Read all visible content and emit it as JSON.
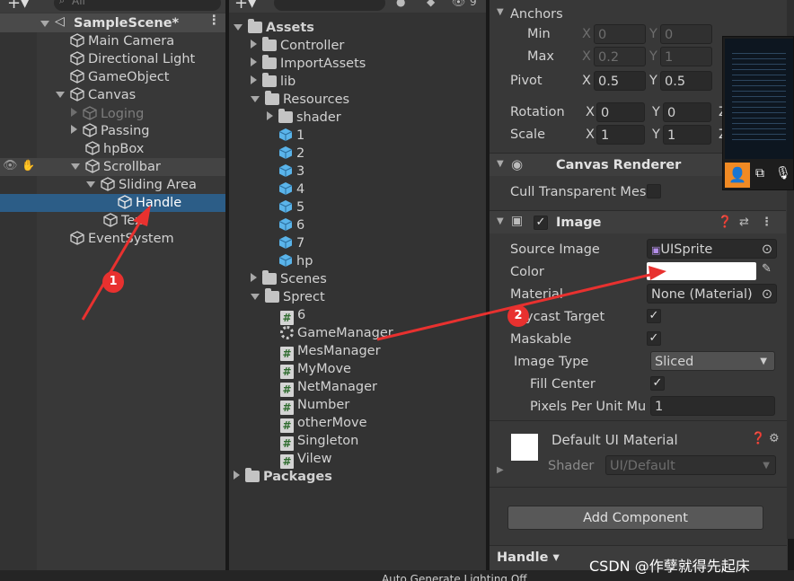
{
  "hierarchy": {
    "search_placeholder": "All",
    "scene": "SampleScene*",
    "items": [
      {
        "label": "Main Camera"
      },
      {
        "label": "Directional Light"
      },
      {
        "label": "GameObject"
      },
      {
        "label": "Canvas"
      },
      {
        "label": "Loging"
      },
      {
        "label": "Passing"
      },
      {
        "label": "hpBox"
      },
      {
        "label": "Scrollbar"
      },
      {
        "label": "Sliding Area"
      },
      {
        "label": "Handle"
      },
      {
        "label": "Tex"
      },
      {
        "label": "EventSystem"
      }
    ]
  },
  "project": {
    "items": [
      {
        "label": "Assets"
      },
      {
        "label": "Controller"
      },
      {
        "label": "ImportAssets"
      },
      {
        "label": "lib"
      },
      {
        "label": "Resources"
      },
      {
        "label": "shader"
      },
      {
        "label": "1"
      },
      {
        "label": "2"
      },
      {
        "label": "3"
      },
      {
        "label": "4"
      },
      {
        "label": "5"
      },
      {
        "label": "6"
      },
      {
        "label": "7"
      },
      {
        "label": "hp"
      },
      {
        "label": "Scenes"
      },
      {
        "label": "Sprect"
      },
      {
        "label": "6"
      },
      {
        "label": "GameManager"
      },
      {
        "label": "MesManager"
      },
      {
        "label": "MyMove"
      },
      {
        "label": "NetManager"
      },
      {
        "label": "Number"
      },
      {
        "label": "otherMove"
      },
      {
        "label": "Singleton"
      },
      {
        "label": "Vilew"
      },
      {
        "label": "Packages"
      }
    ],
    "top_count": "9"
  },
  "inspector": {
    "anchors": "Anchors",
    "min": "Min",
    "max": "Max",
    "min_x": "0",
    "min_y": "0",
    "max_x": "0.2",
    "max_y": "1",
    "pivot": "Pivot",
    "pivot_x": "0.5",
    "pivot_y": "0.5",
    "rotation": "Rotation",
    "rot_x": "0",
    "rot_y": "0",
    "scale": "Scale",
    "scale_x": "1",
    "scale_y": "1",
    "x": "X",
    "y": "Y",
    "z": "Z",
    "canvas_renderer": "Canvas Renderer",
    "cull_label": "Cull Transparent Mes",
    "image_title": "Image",
    "source_image_label": "Source Image",
    "source_image_value": "UISprite",
    "color_label": "Color",
    "material_label": "Material",
    "material_value": "None (Material)",
    "raycast_label": "ycast Target",
    "maskable_label": "Maskable",
    "image_type_label": "Image Type",
    "image_type_value": "Sliced",
    "fill_center_label": "Fill Center",
    "ppu_label": "Pixels Per Unit Mu",
    "ppu_value": "1",
    "default_material": "Default UI Material",
    "shader_label": "Shader",
    "shader_value": "UI/Default",
    "add_component": "Add Component",
    "bottom_handle": "Handle"
  },
  "annotations": {
    "one": "1",
    "two": "2"
  },
  "watermark": "CSDN @作孽就得先起床",
  "status_text": "Auto Generate Lighting Off"
}
